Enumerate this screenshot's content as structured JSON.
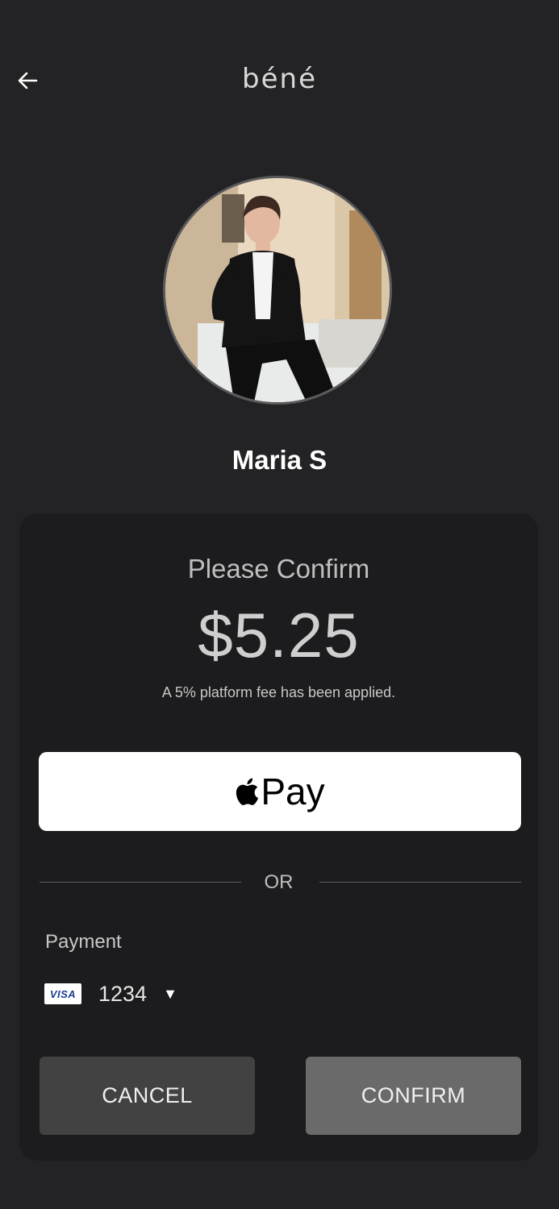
{
  "header": {
    "back_icon": "arrow-left-icon",
    "logo_text": "béné"
  },
  "profile": {
    "name": "Maria S",
    "avatar": "profile-photo"
  },
  "confirm_card": {
    "title": "Please Confirm",
    "amount": "$5.25",
    "fee_note": "A 5% platform fee has been applied.",
    "apple_pay": {
      "icon": "apple-icon",
      "label": "Pay"
    },
    "or_text": "OR",
    "payment": {
      "label": "Payment",
      "card_brand": "VISA",
      "card_last4": "1234",
      "dropdown_icon": "▼"
    },
    "buttons": {
      "cancel": "CANCEL",
      "confirm": "CONFIRM"
    }
  },
  "colors": {
    "background": "#232224",
    "card_background": "#1c1b1d",
    "cancel_button": "#424243",
    "confirm_button": "#6a6a6a",
    "apple_pay_button": "#ffffff"
  }
}
